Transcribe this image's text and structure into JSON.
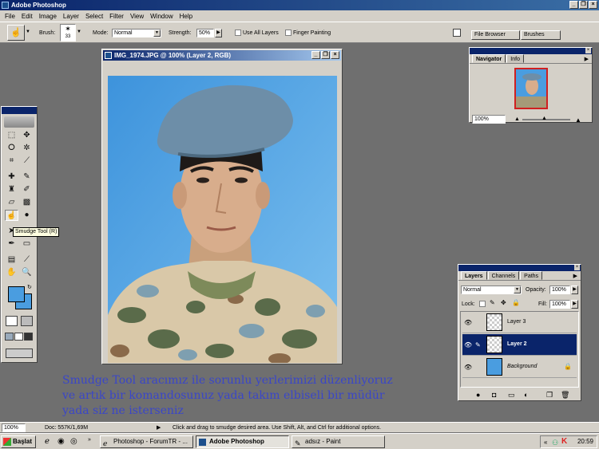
{
  "app": {
    "title": "Adobe Photoshop"
  },
  "menu": [
    "File",
    "Edit",
    "Image",
    "Layer",
    "Select",
    "Filter",
    "View",
    "Window",
    "Help"
  ],
  "options": {
    "brush_label": "Brush:",
    "brush_size": "33",
    "mode_label": "Mode:",
    "mode_value": "Normal",
    "strength_label": "Strength:",
    "strength_value": "50%",
    "use_all_layers": "Use All Layers",
    "finger_painting": "Finger Painting",
    "well_tabs": [
      "File Browser",
      "Brushes"
    ]
  },
  "document": {
    "title": "IMG_1974.JPG @ 100% (Layer 2, RGB)"
  },
  "tooltip": "Smudge Tool (R)",
  "navigator": {
    "tabs": [
      "Navigator",
      "Info"
    ],
    "zoom": "100%"
  },
  "layers": {
    "tabs": [
      "Layers",
      "Channels",
      "Paths"
    ],
    "blend": "Normal",
    "opacity_label": "Opacity:",
    "opacity": "100%",
    "lock_label": "Lock:",
    "fill_label": "Fill:",
    "fill": "100%",
    "items": [
      {
        "name": "Layer 3"
      },
      {
        "name": "Layer 2"
      },
      {
        "name": "Background"
      }
    ]
  },
  "caption": "Smudge Tool aracımız ile sorunlu yerlerimizi düzenliyoruz\nve artık  bir komandosunuz yada  takım elbiseli bir müdür\nyada  siz ne isterseniz",
  "status": {
    "zoom": "100%",
    "doc": "Doc: 557K/1,69M",
    "hint": "Click and drag to smudge desired area.  Use Shift, Alt, and Ctrl for additional options."
  },
  "taskbar": {
    "start": "Başlat",
    "tasks": [
      "Photoshop - ForumTR - ...",
      "Adobe Photoshop",
      "adsız - Paint"
    ],
    "clock": "20:59"
  },
  "colors": {
    "foreground": "#4a9de0",
    "background": "#4a9de0",
    "titlebar": "#0a246a"
  }
}
